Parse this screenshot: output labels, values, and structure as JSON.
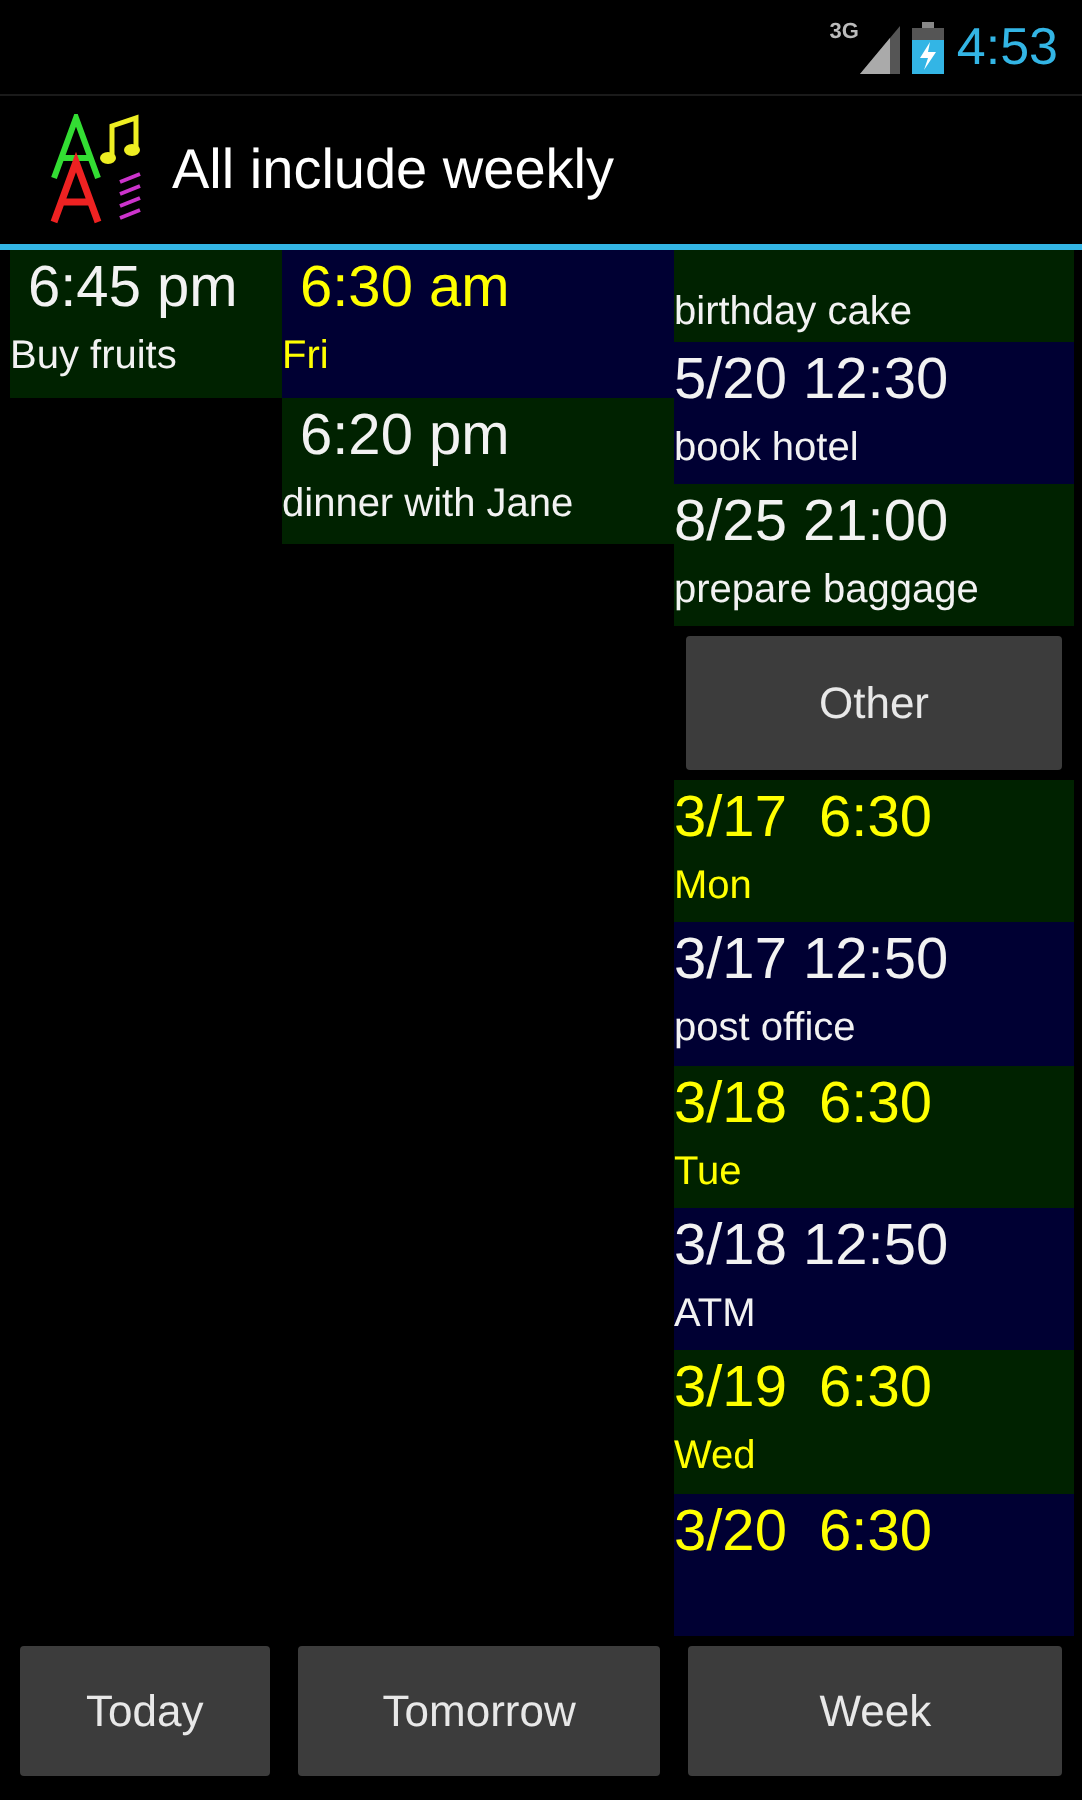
{
  "status_bar": {
    "network": "3G",
    "time": "4:53"
  },
  "action_bar": {
    "title": "All include weekly"
  },
  "columns": [
    [
      {
        "kind": "task",
        "time": "6:45 pm",
        "title": "Buy fruits",
        "color": "#002200"
      }
    ],
    [
      {
        "kind": "routine",
        "time": "6:30 am",
        "title": "Fri",
        "color": "#000033"
      },
      {
        "kind": "task",
        "time": "6:20 pm",
        "title": "dinner with Jane",
        "color": "#002200"
      }
    ],
    [
      {
        "kind": "task",
        "title": "birthday cake",
        "color": "#002200"
      },
      {
        "kind": "task",
        "time": "5/20 12:30",
        "title": "book hotel",
        "color": "#000033"
      },
      {
        "kind": "task",
        "time": "8/25 21:00",
        "title": "prepare baggage",
        "color": "#002200"
      },
      {
        "kind": "button",
        "label": "Other"
      },
      {
        "kind": "routine",
        "time": "3/17  6:30",
        "title": "Mon",
        "color": "#002200"
      },
      {
        "kind": "task",
        "time": "3/17 12:50",
        "title": "post office",
        "color": "#000033"
      },
      {
        "kind": "routine",
        "time": "3/18  6:30",
        "title": "Tue",
        "color": "#002200"
      },
      {
        "kind": "task",
        "time": "3/18 12:50",
        "title": "ATM",
        "color": "#000033"
      },
      {
        "kind": "routine",
        "time": "3/19  6:30",
        "title": "Wed",
        "color": "#002200"
      },
      {
        "kind": "routine",
        "time": "3/20  6:30",
        "color": "#000033"
      }
    ]
  ],
  "buttons": [
    "Today",
    "Tomorrow",
    "Week"
  ]
}
